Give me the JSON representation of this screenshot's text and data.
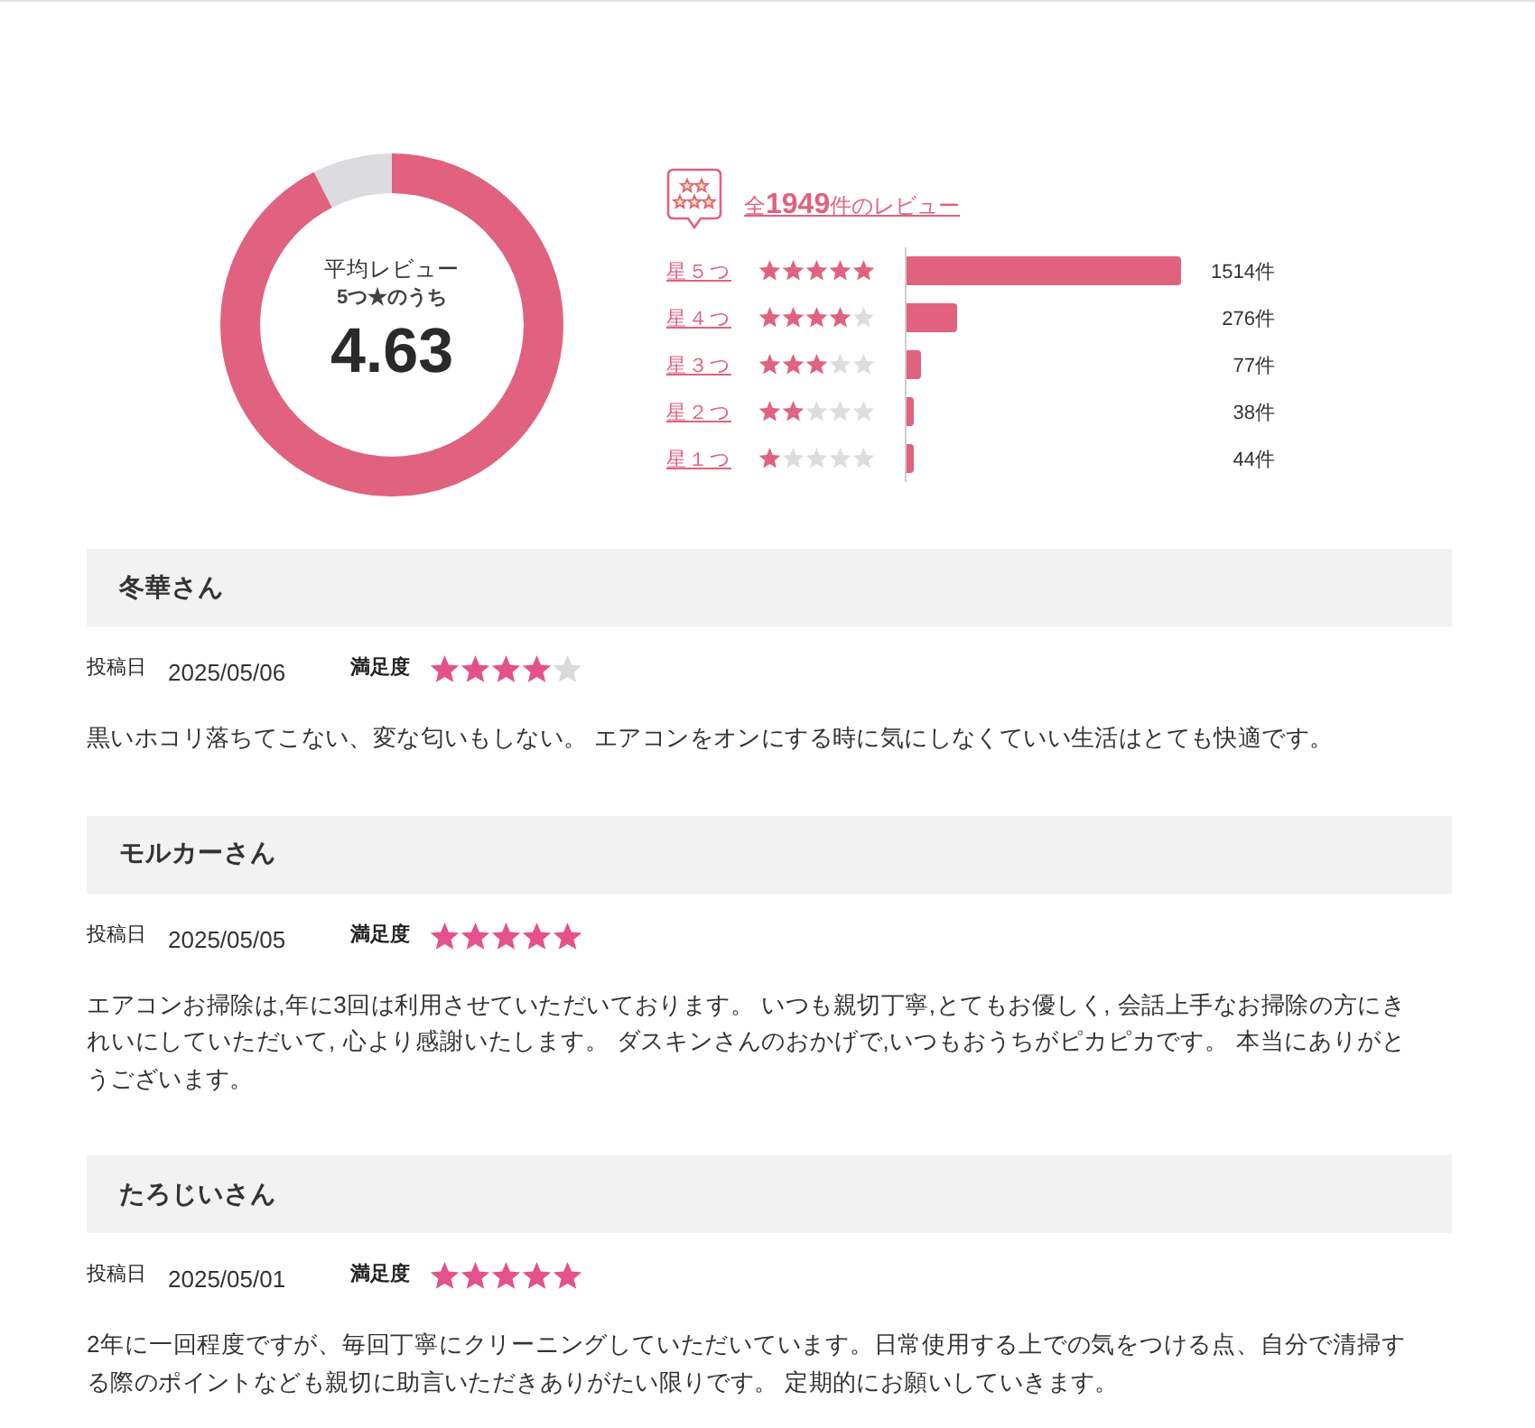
{
  "summary": {
    "caption": "平均レビュー",
    "scale": "5つ★のうち",
    "average": "4.63",
    "level": 0.926
  },
  "breakdown": {
    "total": "全**1949**件のレビュー",
    "rows": [
      {
        "label": "星５つ",
        "stars": 5,
        "level": 1.0,
        "count": "1514件"
      },
      {
        "label": "星４つ",
        "stars": 4,
        "level": 0.182,
        "count": "276件"
      },
      {
        "label": "星３つ",
        "stars": 3,
        "level": 0.051,
        "count": "77件"
      },
      {
        "label": "星２つ",
        "stars": 2,
        "level": 0.025,
        "count": "38件"
      },
      {
        "label": "星１つ",
        "stars": 1,
        "level": 0.029,
        "count": "44件"
      }
    ]
  },
  "reviews": [
    {
      "name": "冬華さん",
      "date_label": "投稿日",
      "date": "2025/05/06",
      "rating_label": "満足度",
      "stars": 4,
      "text": "黒いホコリ落ちてこない、変な匂いもしない。 エアコンをオンにする時に気にしなくていい生活はとても快適です。"
    },
    {
      "name": "モルカーさん",
      "date_label": "投稿日",
      "date": "2025/05/05",
      "rating_label": "満足度",
      "stars": 5,
      "text": "エアコンお掃除は,年に3回は利用させていただいております。 いつも親切丁寧,とてもお優しく, 会話上手なお掃除の方にきれいにしていただいて, 心より感謝いたします。 ダスキンさんのおかげで,いつもおうちがピカピカです。 本当にありがとうございます。"
    },
    {
      "name": "たろじいさん",
      "date_label": "投稿日",
      "date": "2025/05/01",
      "rating_label": "満足度",
      "stars": 5,
      "text": "2年に一回程度ですが、毎回丁寧にクリーニングしていただいています。日常使用する上での気をつける点、自分で清掃する際のポイントなども親切に助言いただきありがたい限りです。 定期的にお願いしていきます。"
    }
  ]
}
